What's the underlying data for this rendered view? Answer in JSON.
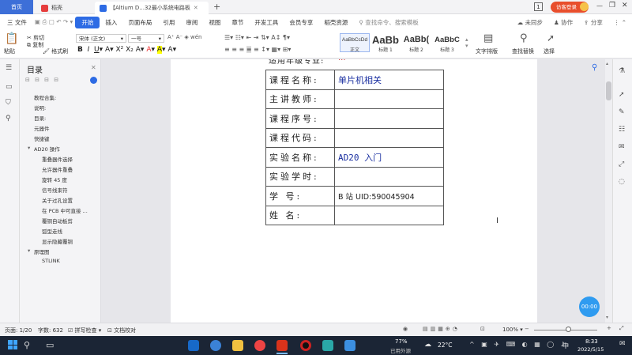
{
  "tabs": {
    "home": "首页",
    "second": "稻壳",
    "doc": "【Altium D...32最小系统电路板",
    "new": "+"
  },
  "window": {
    "badge": "1",
    "login": "访客登录"
  },
  "menu": {
    "file": "三 文件",
    "items": [
      "开始",
      "插入",
      "页面布局",
      "引用",
      "审阅",
      "视图",
      "章节",
      "开发工具",
      "会员专享",
      "稻壳资源"
    ],
    "search": "查找命令、搜索模板",
    "sync": "未同步",
    "collab": "协作",
    "share": "分享"
  },
  "ribbon": {
    "paste": "粘贴",
    "cut": "剪切",
    "copy": "复制",
    "format_painter": "格式刷",
    "font_name": "宋体 (正文)",
    "font_size": "一号",
    "styles": [
      {
        "preview": "AaBbCcDd",
        "name": "正文"
      },
      {
        "preview": "AaBb",
        "name": "标题 1"
      },
      {
        "preview": "AaBb(",
        "name": "标题 2"
      },
      {
        "preview": "AaBbC",
        "name": "标题 3"
      }
    ],
    "text_layout": "文字排版",
    "find_replace": "查找替换",
    "select": "选择"
  },
  "sidebar": {
    "title": "目录",
    "items": [
      {
        "label": "教程合集:",
        "level": 1
      },
      {
        "label": "说明:",
        "level": 1
      },
      {
        "label": "目录:",
        "level": 1
      },
      {
        "label": "元器件",
        "level": 1
      },
      {
        "label": "快捷键",
        "level": 1
      },
      {
        "label": "AD20 操作",
        "level": 1,
        "expandable": true
      },
      {
        "label": "重叠器件选择",
        "level": 2
      },
      {
        "label": "允许器件重叠",
        "level": 2
      },
      {
        "label": "旋转 45 度",
        "level": 2
      },
      {
        "label": "信号线束符",
        "level": 2
      },
      {
        "label": "关于过孔设置",
        "level": 2
      },
      {
        "label": "在 PCB 中可直接 ...",
        "level": 2
      },
      {
        "label": "覆铜自动板剪",
        "level": 2
      },
      {
        "label": "弧型走线",
        "level": 2
      },
      {
        "label": "显示隐藏覆铜",
        "level": 2
      },
      {
        "label": "原理图",
        "level": 1,
        "expandable": true
      },
      {
        "label": "STLINK",
        "level": 2
      }
    ]
  },
  "document": {
    "partial_row": {
      "label": "适用年级专业:",
      "value": "..."
    },
    "rows": [
      {
        "label": "课程名称:",
        "value": "单片机相关"
      },
      {
        "label": "主讲教师:",
        "value": ""
      },
      {
        "label": "课程序号:",
        "value": ""
      },
      {
        "label": "课程代码:",
        "value": ""
      },
      {
        "label": "实验名称:",
        "value": "AD20 入门"
      },
      {
        "label": "实验学时:",
        "value": ""
      },
      {
        "label": "学      号:",
        "value": "B 站   UID:590045904"
      },
      {
        "label": "姓      名:",
        "value": ""
      }
    ]
  },
  "float_button": "00:00",
  "status": {
    "page": "页面: 1/20",
    "words": "字数: 632",
    "spell": "拼写检查",
    "compare": "文档校对",
    "zoom": "100%"
  },
  "taskbar": {
    "battery": "77%",
    "battery_status": "已用外源",
    "temp": "22°C",
    "time": "8:33",
    "date": "2022/5/15",
    "lang": "中"
  },
  "colors": {
    "accent": "#2d6be4",
    "doc_value": "#1a2fa0",
    "taskbar": "#1b2535"
  }
}
